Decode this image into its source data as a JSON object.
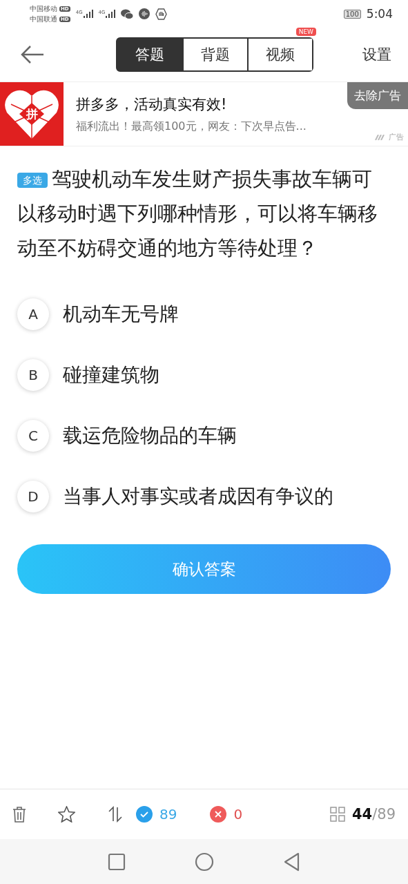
{
  "status_bar": {
    "carriers": [
      {
        "name": "中国移动",
        "badge": "HD"
      },
      {
        "name": "中国联通",
        "badge": "HD"
      }
    ],
    "network_labels": [
      "4G",
      "4G"
    ],
    "battery": "100",
    "time": "5:04"
  },
  "header": {
    "tabs": [
      {
        "label": "答题",
        "selected": true
      },
      {
        "label": "背题",
        "selected": false
      },
      {
        "label": "视频",
        "selected": false,
        "badge": "NEW"
      }
    ],
    "settings": "设置"
  },
  "ad": {
    "logo_text": "拼",
    "title": "拼多多，活动真实有效!",
    "subtitle": "福利流出！最高领100元，网友：下次早点告...",
    "remove": "去除广告",
    "ad_label": "广告"
  },
  "question": {
    "type_badge": "多选",
    "text": "驾驶机动车发生财产损失事故车辆可以移动时遇下列哪种情形，可以将车辆移动至不妨碍交通的地方等待处理？",
    "options": [
      {
        "letter": "A",
        "text": "机动车无号牌",
        "selected": false
      },
      {
        "letter": "B",
        "text": "碰撞建筑物",
        "selected": false
      },
      {
        "letter": "C",
        "text": "载运危险物品的车辆",
        "selected": false
      },
      {
        "letter": "D",
        "text": "当事人对事实或者成因有争议的",
        "selected": false
      }
    ],
    "confirm": "确认答案"
  },
  "bottom_bar": {
    "correct": "89",
    "wrong": "0",
    "current": "44",
    "total": "/89"
  }
}
